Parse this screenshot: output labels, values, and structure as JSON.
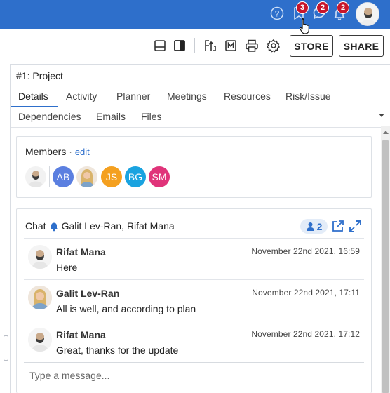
{
  "topbar": {
    "help_icon": "question-circle-icon",
    "bookmark_badge": "3",
    "chat_badge": "2",
    "bell_badge": "2",
    "accent": "#2e6fcb",
    "badge_color": "#c8162b"
  },
  "toolbar": {
    "store_label": "STORE",
    "share_label": "SHARE"
  },
  "panel": {
    "title": "#1: Project",
    "tabs_row1": [
      "Details",
      "Activity",
      "Planner",
      "Meetings",
      "Resources",
      "Risk/Issue"
    ],
    "tabs_row2": [
      "Dependencies",
      "Emails",
      "Files"
    ],
    "active_tab": "Details"
  },
  "members": {
    "title": "Members",
    "separator": "·",
    "edit_label": "edit",
    "avatars": [
      {
        "initials": "",
        "color": "#f2f2f2"
      },
      {
        "initials": "AB",
        "color": "#5b7fe0"
      },
      {
        "initials": "",
        "color": "#e8d8c8"
      },
      {
        "initials": "JS",
        "color": "#f4a020"
      },
      {
        "initials": "BG",
        "color": "#1aa3e0"
      },
      {
        "initials": "SM",
        "color": "#e0347a"
      }
    ]
  },
  "chat": {
    "label": "Chat",
    "participants": "Galit Lev-Ran, Rifat Mana",
    "member_count": "2",
    "messages": [
      {
        "name": "Rifat Mana",
        "text": "Here",
        "time": "November 22nd 2021, 16:59"
      },
      {
        "name": "Galit Lev-Ran",
        "text": "All is well, and according to plan",
        "time": "November 22nd 2021, 17:11"
      },
      {
        "name": "Rifat Mana",
        "text": "Great, thanks for the update",
        "time": "November 22nd 2021, 17:12"
      }
    ],
    "input_placeholder": "Type a message..."
  }
}
